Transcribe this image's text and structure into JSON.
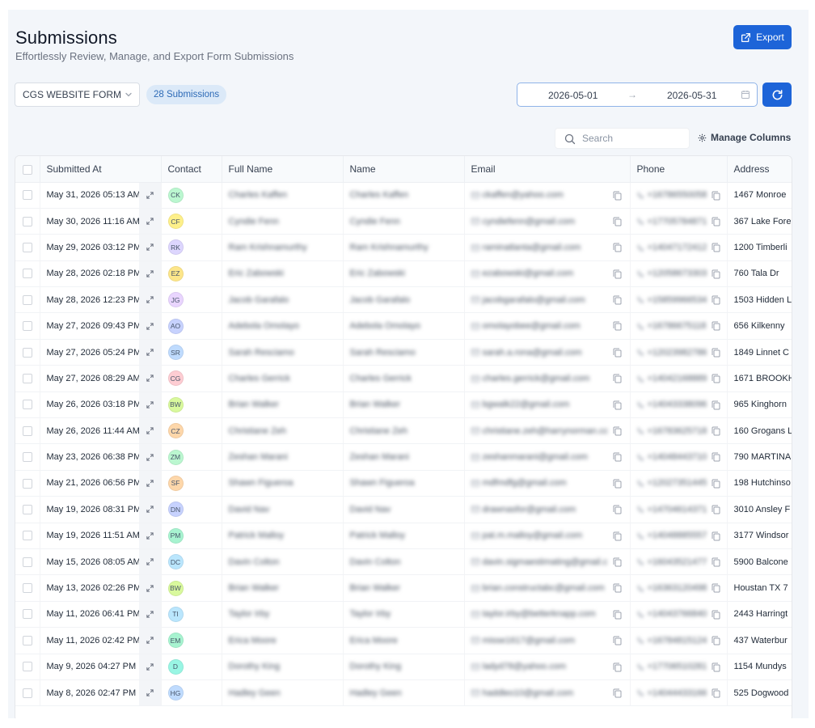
{
  "header": {
    "title": "Submissions",
    "subtitle": "Effortlessly Review, Manage, and Export Form Submissions",
    "export_label": "Export"
  },
  "filters": {
    "form_select": "CGS WEBSITE FORM",
    "count_label": "28 Submissions",
    "date_start": "2026-05-01",
    "date_end": "2026-05-31",
    "date_arrow": "→"
  },
  "toolbar": {
    "search_placeholder": "Search",
    "manage_columns_label": "Manage Columns"
  },
  "columns": {
    "submitted_at": "Submitted At",
    "contact": "Contact",
    "full_name": "Full Name",
    "name": "Name",
    "email": "Email",
    "phone": "Phone",
    "address": "Address"
  },
  "rows": [
    {
      "submitted_at": "May 31, 2026 05:13 AM",
      "initials": "CK",
      "avatar_color": "#bbf7d0",
      "full_name": "Charles Kaffen",
      "name": "Charles Kaffen",
      "email": "ckaffen@yahoo.com",
      "phone": "+16786550058",
      "address": "1467 Monroe"
    },
    {
      "submitted_at": "May 30, 2026 11:16 AM",
      "initials": "CF",
      "avatar_color": "#fef08a",
      "full_name": "Cyndie Fenn",
      "name": "Cyndie Fenn",
      "email": "cyndiefenn@gmail.com",
      "phone": "+17705784871",
      "address": "367 Lake Fore"
    },
    {
      "submitted_at": "May 29, 2026 03:12 PM",
      "initials": "RK",
      "avatar_color": "#ddd6fe",
      "full_name": "Ram Krishnamurthy",
      "name": "Ram Krishnamurthy",
      "email": "raminatlanta@gmail.com",
      "phone": "+14047172412",
      "address": "1200 Timberli"
    },
    {
      "submitted_at": "May 28, 2026 02:18 PM",
      "initials": "EZ",
      "avatar_color": "#fde68a",
      "full_name": "Eric Zabowski",
      "name": "Eric Zabowski",
      "email": "ezabowski@gmail.com",
      "phone": "+12058673303",
      "address": "760 Tala Dr"
    },
    {
      "submitted_at": "May 28, 2026 12:23 PM",
      "initials": "JG",
      "avatar_color": "#e9d5ff",
      "full_name": "Jacob Garafalo",
      "name": "Jacob Garafalo",
      "email": "jacobgarafalo@gmail.com",
      "phone": "+15859966534",
      "address": "1503 Hidden L"
    },
    {
      "submitted_at": "May 27, 2026 09:43 PM",
      "initials": "AO",
      "avatar_color": "#c7d2fe",
      "full_name": "Adebola Omolayo",
      "name": "Adebola Omolayo",
      "email": "omolayobee@gmail.com",
      "phone": "+16786675118",
      "address": "656 Kilkenny"
    },
    {
      "submitted_at": "May 27, 2026 05:24 PM",
      "initials": "SR",
      "avatar_color": "#bfdbfe",
      "full_name": "Sarah Resciamo",
      "name": "Sarah Resciamo",
      "email": "sarah.a.rona@gmail.com",
      "phone": "+12023982786",
      "address": "1849 Linnet C"
    },
    {
      "submitted_at": "May 27, 2026 08:29 AM",
      "initials": "CG",
      "avatar_color": "#fecdd3",
      "full_name": "Charles Gerrick",
      "name": "Charles Gerrick",
      "email": "charles.gerrick@gmail.com",
      "phone": "+14042168889",
      "address": "1671 BROOKH"
    },
    {
      "submitted_at": "May 26, 2026 03:18 PM",
      "initials": "BW",
      "avatar_color": "#d9f99d",
      "full_name": "Brian Walker",
      "name": "Brian Walker",
      "email": "bgwalk22@gmail.com",
      "phone": "+14043338096",
      "address": "965 Kinghorn"
    },
    {
      "submitted_at": "May 26, 2026 11:44 AM",
      "initials": "CZ",
      "avatar_color": "#fed7aa",
      "full_name": "Christiane Zeh",
      "name": "Christiane Zeh",
      "email": "christiane.zeh@harrynorman.cc",
      "phone": "+16783625718",
      "address": "160 Grogans L"
    },
    {
      "submitted_at": "May 23, 2026 06:38 PM",
      "initials": "ZM",
      "avatar_color": "#bbf7d0",
      "full_name": "Zeshan Marani",
      "name": "Zeshan Marani",
      "email": "zeshanmarani@gmail.com",
      "phone": "+14048443710",
      "address": "790 MARTINA"
    },
    {
      "submitted_at": "May 21, 2026 06:56 PM",
      "initials": "SF",
      "avatar_color": "#fed7aa",
      "full_name": "Shawn Figueroa",
      "name": "Shawn Figueroa",
      "email": "mdfmdfg@gmail.com",
      "phone": "+12027351445",
      "address": "198 Hutchinso"
    },
    {
      "submitted_at": "May 19, 2026 08:31 PM",
      "initials": "DN",
      "avatar_color": "#c7d2fe",
      "full_name": "David Nav",
      "name": "David Nav",
      "email": "drawnasfor@gmail.com",
      "phone": "+14704614371",
      "address": "3010 Ansley F"
    },
    {
      "submitted_at": "May 19, 2026 11:51 AM",
      "initials": "PM",
      "avatar_color": "#a7f3d0",
      "full_name": "Patrick Malloy",
      "name": "Patrick Malloy",
      "email": "pat.m.malloy@gmail.com",
      "phone": "+14048885557",
      "address": "3177 Windsor"
    },
    {
      "submitted_at": "May 15, 2026 08:05 AM",
      "initials": "DC",
      "avatar_color": "#bae6fd",
      "full_name": "Davin Colton",
      "name": "Davin Colton",
      "email": "davin.sigmaestimating@gmail.c",
      "phone": "+16043521477",
      "address": "5900 Balcone"
    },
    {
      "submitted_at": "May 13, 2026 02:26 PM",
      "initials": "BW",
      "avatar_color": "#d9f99d",
      "full_name": "Brian Walker",
      "name": "Brian Walker",
      "email": "brian.constructabc@gmail.com",
      "phone": "+16363120498",
      "address": "Houstan TX 7"
    },
    {
      "submitted_at": "May 11, 2026 06:41 PM",
      "initials": "TI",
      "avatar_color": "#bae6fd",
      "full_name": "Taylor Irby",
      "name": "Taylor Irby",
      "email": "taylor.irby@betterknapp.com",
      "phone": "+14043766840",
      "address": "2443 Harringt"
    },
    {
      "submitted_at": "May 11, 2026 02:42 PM",
      "initials": "EM",
      "avatar_color": "#a7f3d0",
      "full_name": "Erica Moore",
      "name": "Erica Moore",
      "email": "misse1617@gmail.com",
      "phone": "+16784815124",
      "address": "437 Waterbur"
    },
    {
      "submitted_at": "May 9, 2026 04:27 PM",
      "initials": "D",
      "avatar_color": "#99f6e4",
      "full_name": "Dorothy King",
      "name": "Dorothy King",
      "email": "ladyd78@yahoo.com",
      "phone": "+17706510281",
      "address": "1154 Mundys"
    },
    {
      "submitted_at": "May 8, 2026 02:47 PM",
      "initials": "HG",
      "avatar_color": "#bfdbfe",
      "full_name": "Hadley Geen",
      "name": "Hadley Geen",
      "email": "haddleo10@gmail.com",
      "phone": "+14044433166",
      "address": "525 Dogwood"
    }
  ],
  "colors": {
    "accent": "#1d64d8",
    "badge_bg": "#dbe9f8",
    "badge_text": "#2e6bb7"
  }
}
